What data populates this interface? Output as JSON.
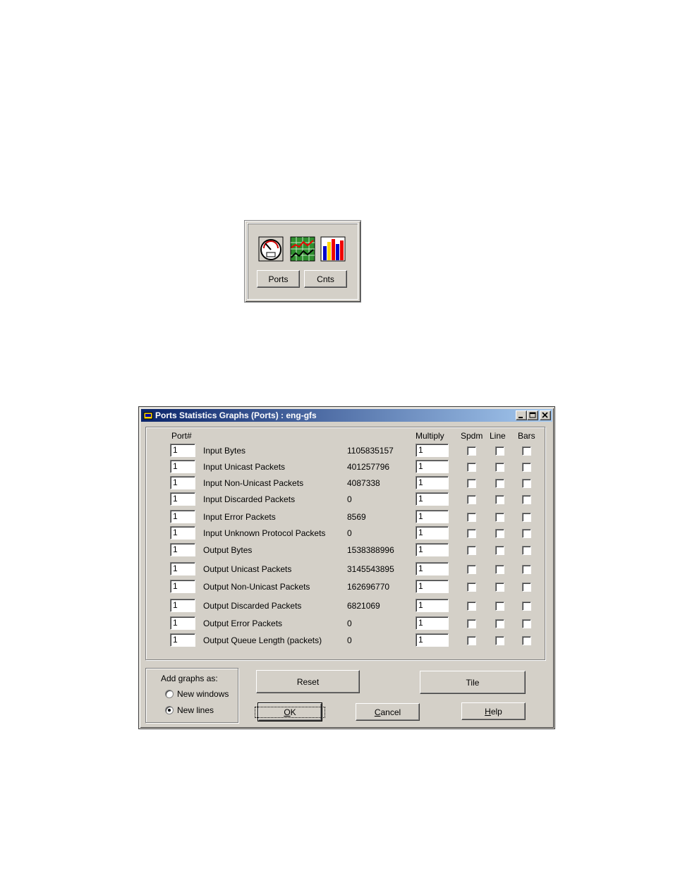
{
  "toolbar": {
    "ports_label": "Ports",
    "cnts_label": "Cnts",
    "icons": [
      "speedometer-icon",
      "line-graph-icon",
      "bar-chart-icon"
    ]
  },
  "dialog": {
    "title": "Ports Statistics Graphs (Ports) : eng-gfs",
    "headers": {
      "port": "Port#",
      "multiply": "Multiply",
      "spdm": "Spdm",
      "line": "Line",
      "bars": "Bars"
    },
    "rows": [
      {
        "port": "1",
        "name": "Input Bytes",
        "value": "1105835157",
        "multiply": "1"
      },
      {
        "port": "1",
        "name": "Input Unicast Packets",
        "value": "401257796",
        "multiply": "1"
      },
      {
        "port": "1",
        "name": "Input Non-Unicast Packets",
        "value": "4087338",
        "multiply": "1"
      },
      {
        "port": "1",
        "name": "Input Discarded Packets",
        "value": "0",
        "multiply": "1"
      },
      {
        "port": "1",
        "name": "Input Error Packets",
        "value": "8569",
        "multiply": "1"
      },
      {
        "port": "1",
        "name": "Input Unknown Protocol Packets",
        "value": "0",
        "multiply": "1"
      },
      {
        "port": "1",
        "name": "Output Bytes",
        "value": "1538388996",
        "multiply": "1"
      },
      {
        "port": "1",
        "name": "Output Unicast Packets",
        "value": "3145543895",
        "multiply": "1"
      },
      {
        "port": "1",
        "name": "Output Non-Unicast Packets",
        "value": "162696770",
        "multiply": "1"
      },
      {
        "port": "1",
        "name": "Output Discarded Packets",
        "value": "6821069",
        "multiply": "1"
      },
      {
        "port": "1",
        "name": "Output Error Packets",
        "value": "0",
        "multiply": "1"
      },
      {
        "port": "1",
        "name": "Output Queue Length (packets)",
        "value": "0",
        "multiply": "1"
      }
    ],
    "add_graphs": {
      "label": "Add graphs as:",
      "options": [
        "New windows",
        "New lines"
      ],
      "selected": "New lines"
    },
    "buttons": {
      "reset": "Reset",
      "tile": "Tile",
      "ok_key": "O",
      "ok_rest": "K",
      "cancel_key": "C",
      "cancel_rest": "ancel",
      "help_key": "H",
      "help_rest": "elp"
    }
  }
}
